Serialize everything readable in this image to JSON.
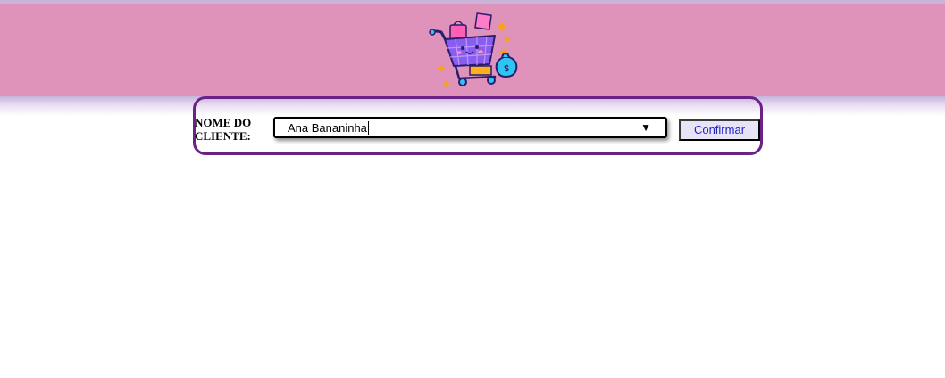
{
  "header": {
    "logo_icon": "shopping-cart-logo-icon",
    "background_color": "#df93bb"
  },
  "form": {
    "client_label": "NOME DO CLIENTE:",
    "client_select": {
      "selected_value": "Ana Bananinha",
      "arrow_icon": "triangle-down-icon"
    },
    "confirm_label": "Confirmar",
    "border_color": "#6b2185"
  }
}
